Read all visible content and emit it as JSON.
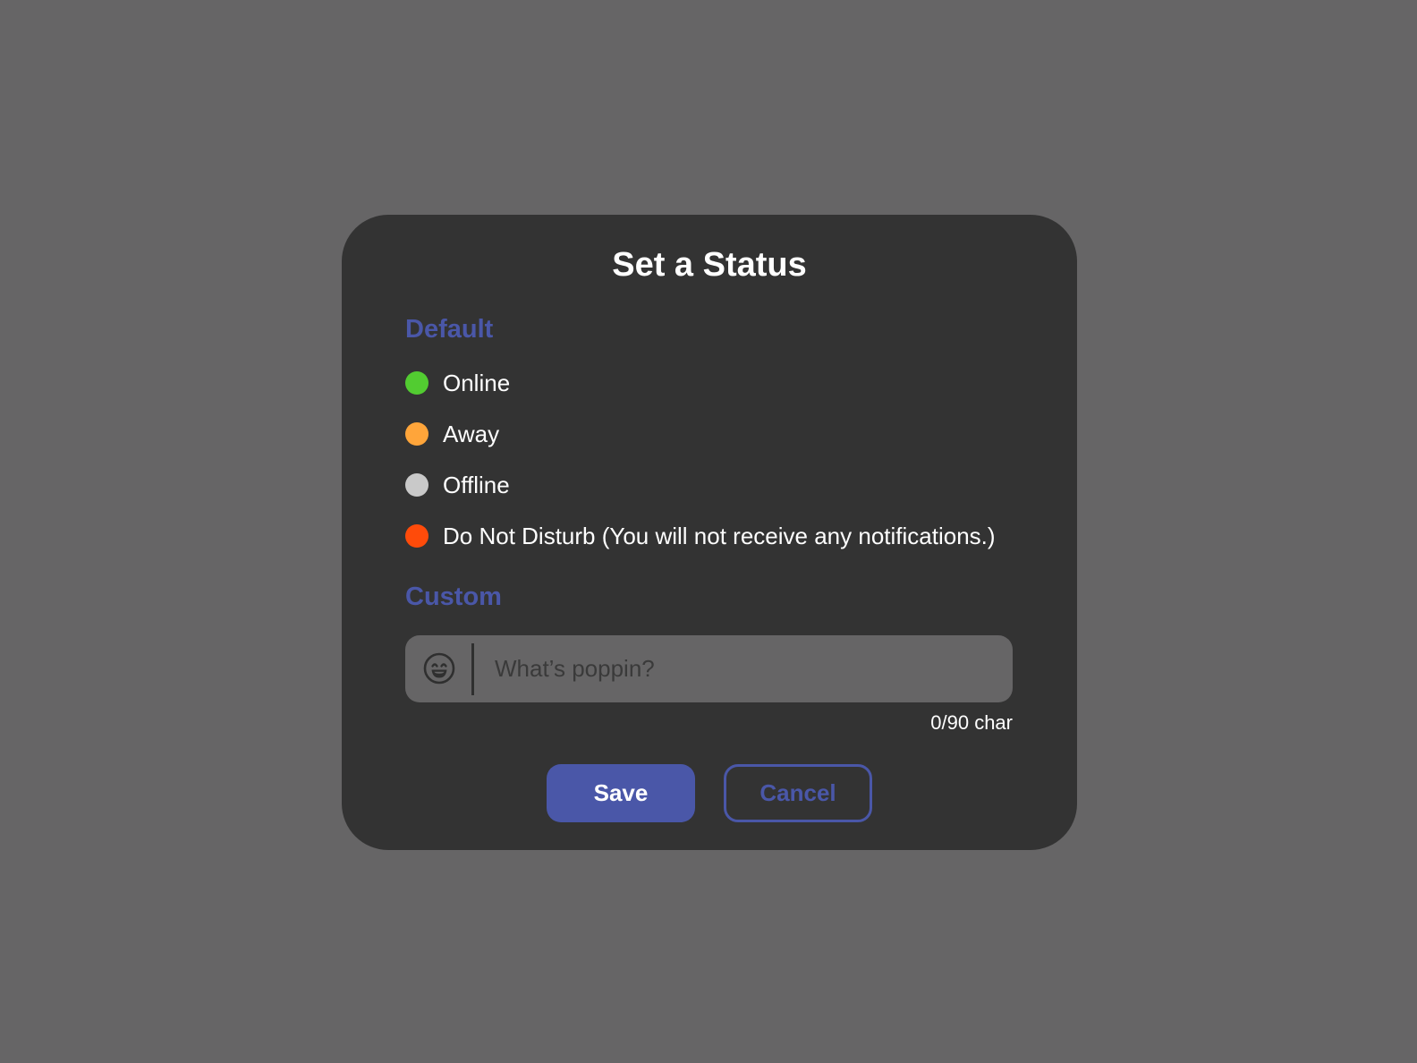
{
  "dialog": {
    "title": "Set a Status"
  },
  "default_section": {
    "heading": "Default",
    "options": [
      {
        "label": "Online",
        "color": "#52cc31"
      },
      {
        "label": "Away",
        "color": "#ffa53a"
      },
      {
        "label": "Offline",
        "color": "#c9c9c9"
      },
      {
        "label": "Do Not Disturb (You will not receive any notifications.)",
        "color": "#ff4b0a"
      }
    ]
  },
  "custom_section": {
    "heading": "Custom",
    "input": {
      "value": "",
      "placeholder": "What’s poppin?"
    },
    "emoji_icon": "grinning-face-icon",
    "char_count": "0/90 char"
  },
  "actions": {
    "save_label": "Save",
    "cancel_label": "Cancel"
  },
  "colors": {
    "background": "#666566",
    "dialog": "#333333",
    "accent": "#4a57a8",
    "text": "#ffffff"
  }
}
